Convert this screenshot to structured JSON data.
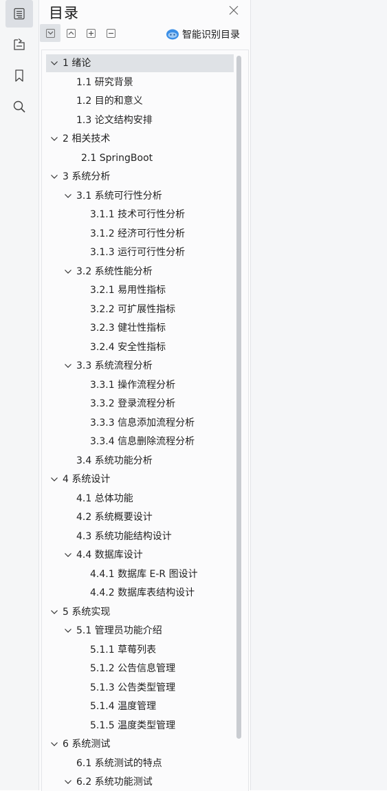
{
  "panel": {
    "title": "目录",
    "smart_label": "智能识别目录"
  },
  "rail": {
    "icons": [
      "outline-icon",
      "tags-icon",
      "bookmark-icon",
      "search-icon"
    ]
  },
  "toolbar": {
    "buttons": [
      "expand-all-icon",
      "collapse-all-icon",
      "plus-icon",
      "minus-icon"
    ]
  },
  "toc": [
    {
      "label": "1  绪论",
      "level": 0,
      "caret": true,
      "selected": true
    },
    {
      "label": "1.1  研究背景",
      "level": 1,
      "caret": false
    },
    {
      "label": "1.2  目的和意义",
      "level": 1,
      "caret": false
    },
    {
      "label": "1.3  论文结构安排",
      "level": 1,
      "caret": false
    },
    {
      "label": "2  相关技术",
      "level": 0,
      "caret": true
    },
    {
      "label": "2.1 SpringBoot",
      "level": 1.35,
      "caret": false
    },
    {
      "label": "3  系统分析",
      "level": 0,
      "caret": true
    },
    {
      "label": "3.1  系统可行性分析",
      "level": 1,
      "caret": true
    },
    {
      "label": "3.1.1  技术可行性分析",
      "level": 2,
      "caret": false
    },
    {
      "label": "3.1.2  经济可行性分析",
      "level": 2,
      "caret": false
    },
    {
      "label": "3.1.3  运行可行性分析",
      "level": 2,
      "caret": false
    },
    {
      "label": "3.2  系统性能分析",
      "level": 1,
      "caret": true
    },
    {
      "label": "3.2.1  易用性指标",
      "level": 2,
      "caret": false
    },
    {
      "label": "3.2.2  可扩展性指标",
      "level": 2,
      "caret": false
    },
    {
      "label": "3.2.3  健壮性指标",
      "level": 2,
      "caret": false
    },
    {
      "label": "3.2.4  安全性指标",
      "level": 2,
      "caret": false
    },
    {
      "label": "3.3  系统流程分析",
      "level": 1,
      "caret": true
    },
    {
      "label": "3.3.1  操作流程分析",
      "level": 2,
      "caret": false
    },
    {
      "label": "3.3.2  登录流程分析",
      "level": 2,
      "caret": false
    },
    {
      "label": "3.3.3  信息添加流程分析",
      "level": 2,
      "caret": false
    },
    {
      "label": "3.3.4  信息删除流程分析",
      "level": 2,
      "caret": false
    },
    {
      "label": "3.4  系统功能分析",
      "level": 1,
      "caret": false
    },
    {
      "label": "4  系统设计",
      "level": 0,
      "caret": true
    },
    {
      "label": "4.1  总体功能",
      "level": 1,
      "caret": false
    },
    {
      "label": "4.2  系统概要设计",
      "level": 1,
      "caret": false
    },
    {
      "label": "4.3  系统功能结构设计",
      "level": 1,
      "caret": false
    },
    {
      "label": "4.4  数据库设计",
      "level": 1,
      "caret": true
    },
    {
      "label": "4.4.1  数据库 E-R 图设计",
      "level": 2,
      "caret": false
    },
    {
      "label": "4.4.2  数据库表结构设计",
      "level": 2,
      "caret": false
    },
    {
      "label": "5  系统实现",
      "level": 0,
      "caret": true
    },
    {
      "label": "5.1  管理员功能介绍",
      "level": 1,
      "caret": true
    },
    {
      "label": "5.1.1  草莓列表",
      "level": 2,
      "caret": false
    },
    {
      "label": "5.1.2  公告信息管理",
      "level": 2,
      "caret": false
    },
    {
      "label": "5.1.3 公告类型管理",
      "level": 2,
      "caret": false
    },
    {
      "label": "5.1.4  温度管理",
      "level": 2,
      "caret": false
    },
    {
      "label": "5.1.5  温度类型管理",
      "level": 2,
      "caret": false
    },
    {
      "label": "6  系统测试",
      "level": 0,
      "caret": true
    },
    {
      "label": "6.1  系统测试的特点",
      "level": 1,
      "caret": false
    },
    {
      "label": "6.2  系统功能测试",
      "level": 1,
      "caret": true
    }
  ],
  "colors": {
    "selected_row": "#dfe2e6",
    "rail_bg": "#f5f6f7",
    "accent": "#3a8ee6"
  }
}
